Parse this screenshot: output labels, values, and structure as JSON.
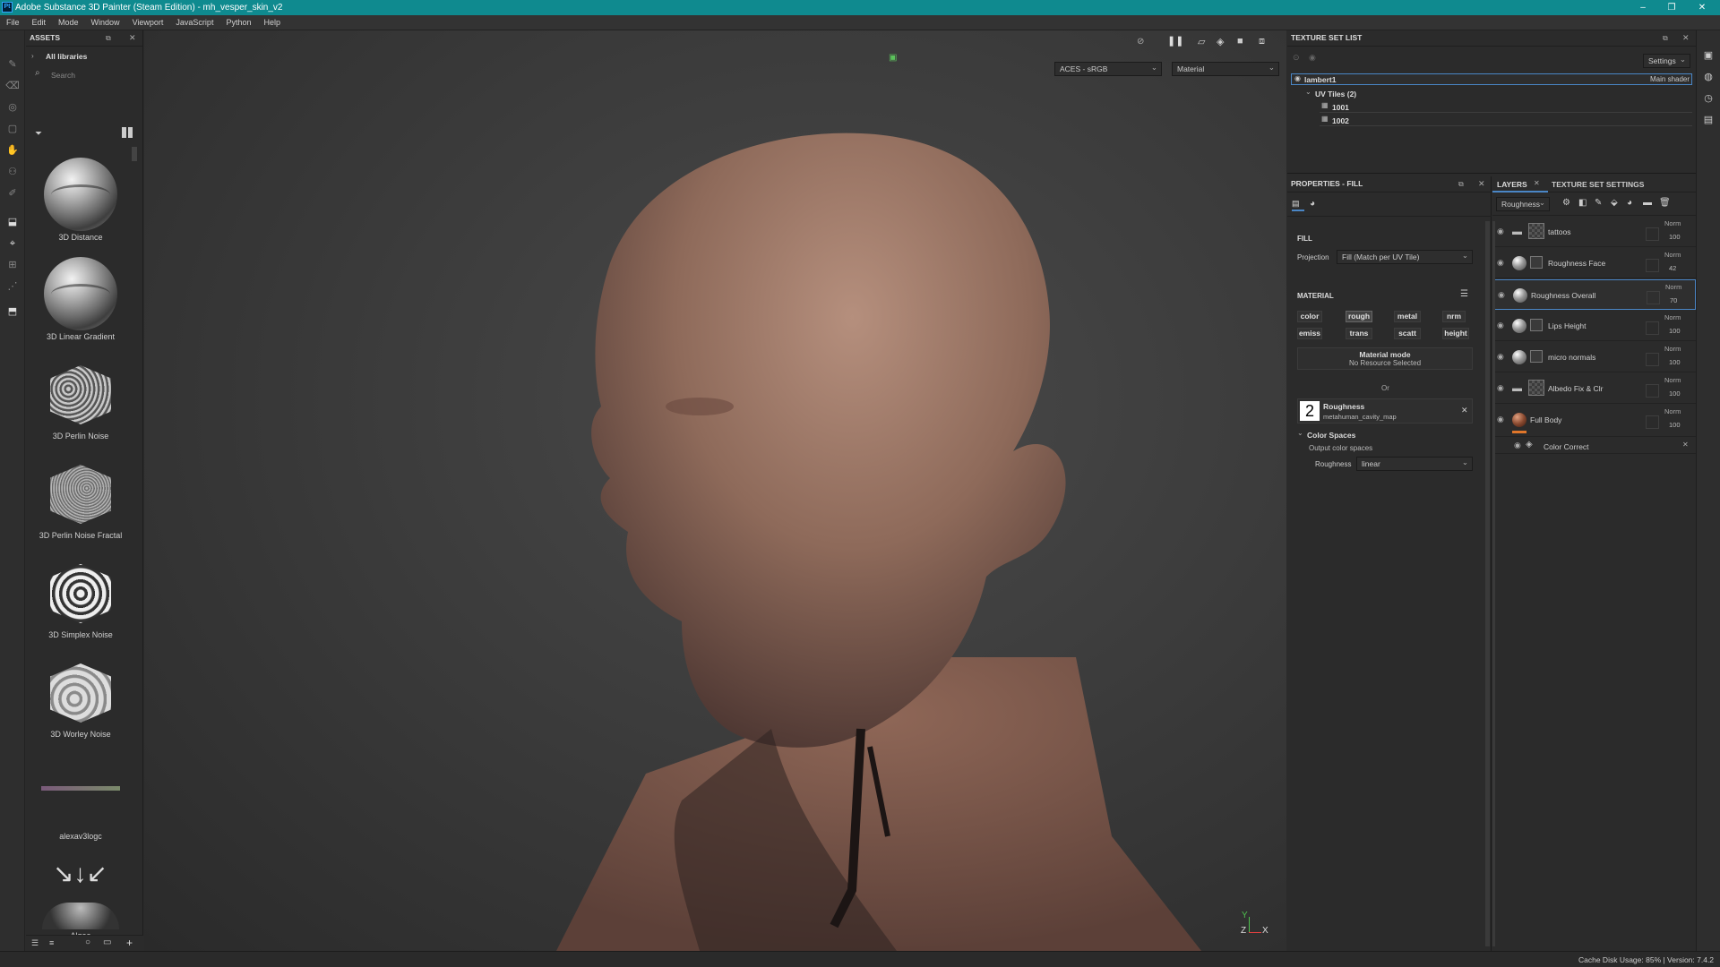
{
  "window": {
    "title": "Adobe Substance 3D Painter (Steam Edition) - mh_vesper_skin_v2",
    "app_badge": "Pt",
    "controls": [
      "–",
      "❐",
      "✕"
    ]
  },
  "menu": [
    "File",
    "Edit",
    "Mode",
    "Window",
    "Viewport",
    "JavaScript",
    "Python",
    "Help"
  ],
  "assets": {
    "title": "ASSETS",
    "library": "All libraries",
    "search_placeholder": "Search",
    "items": [
      "3D Distance",
      "3D Linear Gradient",
      "3D Perlin Noise",
      "3D Perlin Noise Fractal",
      "3D Simplex Noise",
      "3D Worley Noise",
      "alexav3logc",
      "Algea"
    ]
  },
  "viewport": {
    "colorspace": "ACES - sRGB",
    "mode": "Material",
    "axis_z": "Z",
    "axis_x": "X",
    "axis_y": "Y"
  },
  "texture_set_list": {
    "title": "TEXTURE SET LIST",
    "settings": "Settings",
    "set_name": "lambert1",
    "shader": "Main shader",
    "uv_group": "UV Tiles (2)",
    "tiles": [
      "1001",
      "1002"
    ]
  },
  "properties": {
    "title": "PROPERTIES - FILL",
    "fill_header": "FILL",
    "projection_label": "Projection",
    "projection_value": "Fill (Match per UV Tile)",
    "material_header": "MATERIAL",
    "channels": [
      "color",
      "rough",
      "metal",
      "nrm",
      "emiss",
      "trans",
      "scatt",
      "height"
    ],
    "material_mode_title": "Material mode",
    "material_mode_sub": "No Resource Selected",
    "or": "Or",
    "resource_num": "2",
    "resource_title": "Roughness",
    "resource_file": "metahuman_cavity_map",
    "color_spaces": "Color Spaces",
    "output_cs": "Output color spaces",
    "cs_label": "Roughness",
    "cs_value": "linear"
  },
  "layers": {
    "tab_layers": "LAYERS",
    "tab_tss": "TEXTURE SET SETTINGS",
    "channel": "Roughness",
    "rows": [
      {
        "name": "tattoos",
        "blend": "Norm",
        "opacity": "100"
      },
      {
        "name": "Roughness Face",
        "blend": "Norm",
        "opacity": "42"
      },
      {
        "name": "Roughness Overall",
        "blend": "Norm",
        "opacity": "70"
      },
      {
        "name": "Lips Height",
        "blend": "Norm",
        "opacity": "100"
      },
      {
        "name": "micro normals",
        "blend": "Norm",
        "opacity": "100"
      },
      {
        "name": "Albedo Fix & Clr",
        "blend": "Norm",
        "opacity": "100"
      },
      {
        "name": "Full Body",
        "blend": "Norm",
        "opacity": "100"
      }
    ],
    "effect": "Color Correct"
  },
  "status": {
    "text": "Cache Disk Usage:  85% | Version: 7.4.2"
  }
}
